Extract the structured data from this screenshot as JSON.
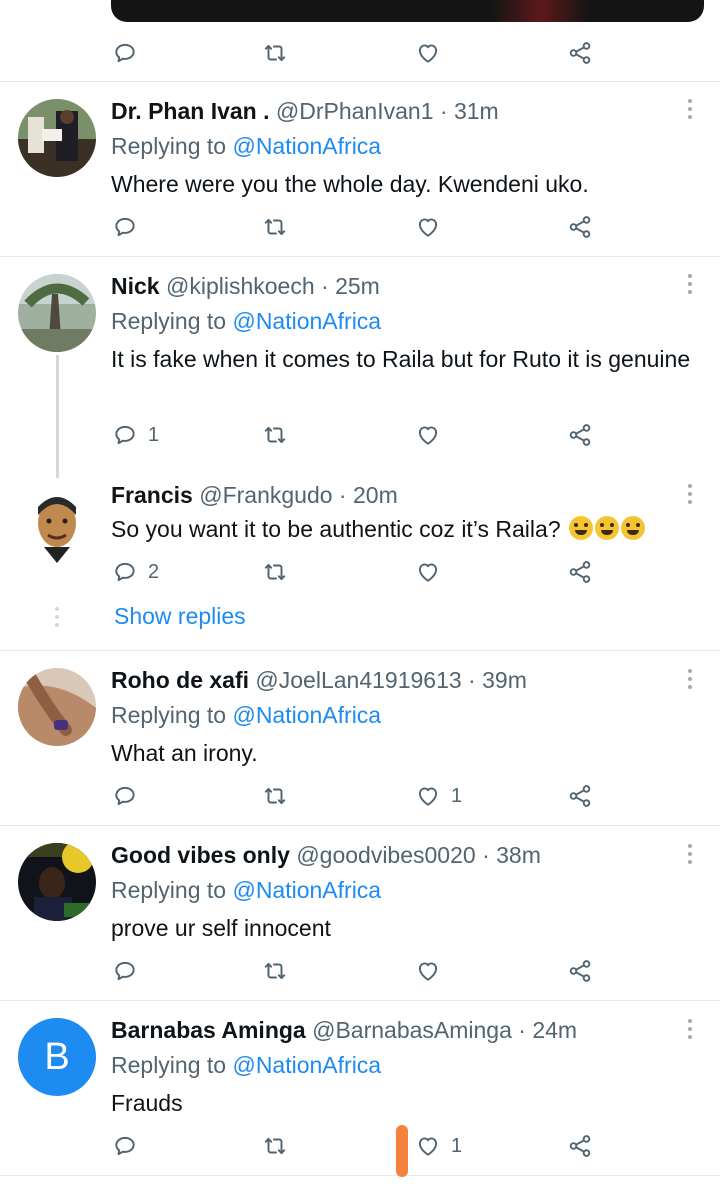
{
  "replying_prefix": "Replying to",
  "tweets": [
    {
      "name": "Dr. Phan Ivan .",
      "handle": "@DrPhanIvan1",
      "time": "31m",
      "replying_to": "@NationAfrica",
      "text": "Where were you the whole day. Kwendeni uko."
    },
    {
      "name": "Nick",
      "handle": "@kiplishkoech",
      "time": "25m",
      "replying_to": "@NationAfrica",
      "text": "It is fake when it comes to Raila but for Ruto it is genuine",
      "reply_count": "1"
    },
    {
      "name": "Francis",
      "handle": "@Frankgudo",
      "time": "20m",
      "text": "So you want it to be authentic coz it’s Raila?",
      "emojis": [
        "rolling-on-floor-laughing",
        "rolling-on-floor-laughing",
        "rolling-on-floor-laughing"
      ],
      "reply_count": "2",
      "show_replies": "Show replies"
    },
    {
      "name": "Roho de xafi",
      "handle": "@JoelLan41919613",
      "time": "39m",
      "replying_to": "@NationAfrica",
      "text": "What an irony.",
      "like_count": "1"
    },
    {
      "name": "Good vibes only",
      "handle": "@goodvibes0020",
      "time": "38m",
      "replying_to": "@NationAfrica",
      "text": "prove ur self innocent"
    },
    {
      "name": "Barnabas Aminga",
      "handle": "@BarnabasAminga",
      "time": "24m",
      "replying_to": "@NationAfrica",
      "text": "Frauds",
      "avatar_letter": "B",
      "like_count": "1"
    }
  ],
  "colors": {
    "accent": "#1d8bf1",
    "secondary_text": "#536471",
    "primary_text": "#0f1419",
    "divider": "#e6e9ec",
    "marker": "#f4823c"
  }
}
